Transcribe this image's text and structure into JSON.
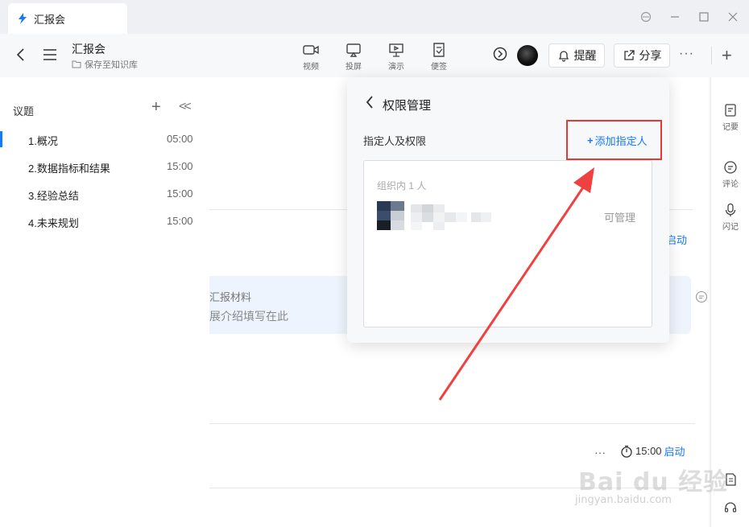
{
  "window": {
    "tab_title": "汇报会",
    "controls": [
      "sync-icon",
      "minimize-icon",
      "maximize-icon",
      "close-icon"
    ]
  },
  "header": {
    "doc_title": "汇报会",
    "save_to": "保存至知识库",
    "tools": [
      {
        "label": "视频",
        "icon": "video-icon"
      },
      {
        "label": "投屏",
        "icon": "cast-icon"
      },
      {
        "label": "演示",
        "icon": "present-icon"
      },
      {
        "label": "便签",
        "icon": "note-icon"
      }
    ],
    "remind_label": "提醒",
    "share_label": "分享",
    "more_label": "···",
    "new_label": "+"
  },
  "sidebar": {
    "heading": "议题",
    "items": [
      {
        "label": "1.概况",
        "time": "05:00"
      },
      {
        "label": "2.数据指标和结果",
        "time": "15:00"
      },
      {
        "label": "3.经验总结",
        "time": "15:00"
      },
      {
        "label": "4.未来规划",
        "time": "15:00"
      }
    ]
  },
  "main": {
    "card_title": "汇报材料",
    "card_sub": "展介绍填写在此",
    "start_label": "启动",
    "row2_more": "···",
    "row2_time": "15:00",
    "row2_start": "启动"
  },
  "rail": {
    "items": [
      {
        "label": "记要",
        "icon": "notes-icon"
      },
      {
        "label": "评论",
        "icon": "comment-icon"
      },
      {
        "label": "闪记",
        "icon": "mic-icon"
      }
    ]
  },
  "popup": {
    "title": "权限管理",
    "section_label": "指定人及权限",
    "add_label": "添加指定人",
    "org_label": "组织内 1 人",
    "member_role": "可管理"
  },
  "watermark": {
    "text": "Bai du 经验",
    "sub": "jingyan.baidu.com"
  },
  "colors": {
    "accent": "#1677ff",
    "annotation_red": "#e53935",
    "card_bg": "#eef4fd"
  }
}
